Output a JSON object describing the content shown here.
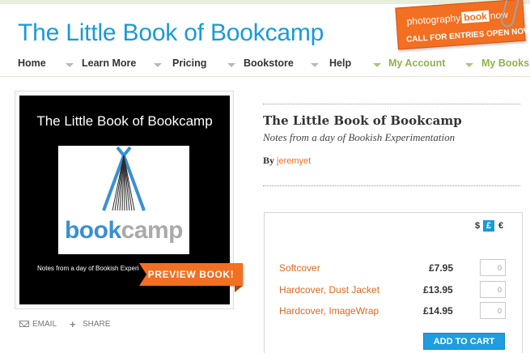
{
  "site": {
    "title": "The Little Book of Bookcamp"
  },
  "promo": {
    "brand_pre": "photography",
    "brand_box": "book",
    "brand_post": "now",
    "call": "CALL FOR ENTRIES OPEN NOW"
  },
  "nav": {
    "items": [
      {
        "label": "Home"
      },
      {
        "label": "Learn More"
      },
      {
        "label": "Pricing"
      },
      {
        "label": "Bookstore"
      },
      {
        "label": "Help"
      },
      {
        "label": "My Account"
      },
      {
        "label": "My Books"
      }
    ]
  },
  "cover": {
    "title": "The Little Book of Bookcamp",
    "logo_word_1": "book",
    "logo_word_2": "camp",
    "subtitle": "Notes from a day of Bookish Experimentation",
    "preview_label": "PREVIEW BOOK!"
  },
  "share": {
    "email_label": "EMAIL",
    "share_label": "SHARE"
  },
  "book": {
    "title": "The Little Book of Bookcamp",
    "subtitle": "Notes from a day of Bookish Experimentation",
    "by_label": "By",
    "author": "jeremyet"
  },
  "pricing": {
    "currencies": [
      {
        "symbol": "$",
        "active": false
      },
      {
        "symbol": "£",
        "active": true
      },
      {
        "symbol": "€",
        "active": false
      }
    ],
    "options": [
      {
        "name": "Softcover",
        "price": "£7.95",
        "qty": "0"
      },
      {
        "name": "Hardcover, Dust Jacket",
        "price": "£13.95",
        "qty": "0"
      },
      {
        "name": "Hardcover, ImageWrap",
        "price": "£14.95",
        "qty": "0"
      }
    ],
    "add_to_cart": "ADD TO CART"
  },
  "colors": {
    "brand_blue": "#1a9ad6",
    "accent_orange": "#f36f21",
    "nav_green": "#8fb34b"
  }
}
